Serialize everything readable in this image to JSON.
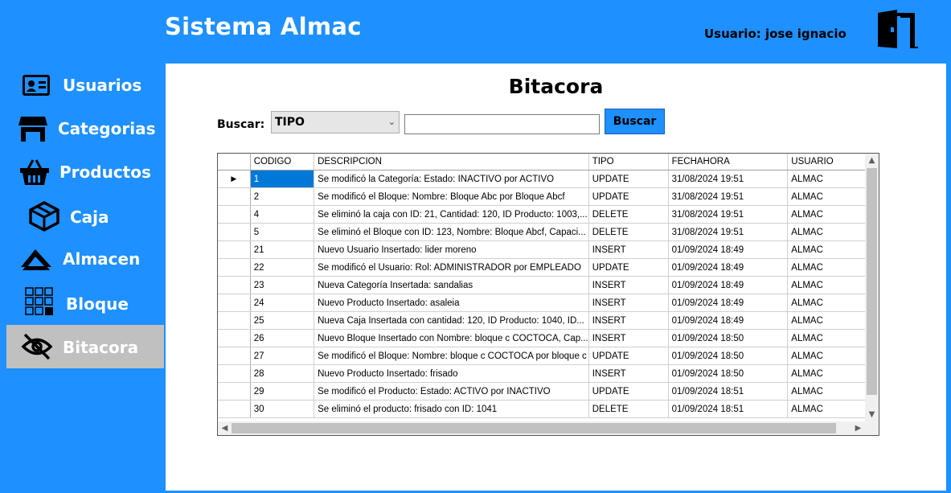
{
  "header": {
    "app_title": "Sistema Almac",
    "user_label": "Usuario: jose ignacio",
    "exit_icon": "door-exit-icon"
  },
  "sidebar": {
    "items": [
      {
        "label": "Usuarios",
        "icon": "id-card-icon"
      },
      {
        "label": "Categorias",
        "icon": "store-icon"
      },
      {
        "label": "Productos",
        "icon": "basket-icon"
      },
      {
        "label": "Caja",
        "icon": "box-icon"
      },
      {
        "label": "Almacen",
        "icon": "warehouse-icon"
      },
      {
        "label": "Bloque",
        "icon": "grid-blocks-icon"
      },
      {
        "label": "Bitacora",
        "icon": "eye-slash-icon",
        "active": true
      }
    ]
  },
  "main": {
    "title": "Bitacora",
    "search": {
      "label": "Buscar:",
      "select_value": "TIPO",
      "input_value": "",
      "button_label": "Buscar"
    },
    "table": {
      "columns": [
        "CODIGO",
        "DESCRIPCION",
        "TIPO",
        "FECHAHORA",
        "USUARIO"
      ],
      "rows": [
        [
          "1",
          "Se modificó la Categoría: Estado: INACTIVO por ACTIVO",
          "UPDATE",
          "31/08/2024 19:51",
          "ALMAC"
        ],
        [
          "2",
          "Se modificó el Bloque: Nombre: Bloque Abc por Bloque Abcf",
          "UPDATE",
          "31/08/2024 19:51",
          "ALMAC"
        ],
        [
          "4",
          "Se eliminó la caja con ID: 21, Cantidad: 120, ID Producto: 1003,...",
          "DELETE",
          "31/08/2024 19:51",
          "ALMAC"
        ],
        [
          "5",
          "Se eliminó el Bloque con ID: 123, Nombre: Bloque Abcf, Capaci...",
          "DELETE",
          "31/08/2024 19:51",
          "ALMAC"
        ],
        [
          "21",
          "Nuevo Usuario Insertado: lider moreno",
          "INSERT",
          "01/09/2024 18:49",
          "ALMAC"
        ],
        [
          "22",
          "Se modificó el Usuario: Rol: ADMINISTRADOR por EMPLEADO",
          "UPDATE",
          "01/09/2024 18:49",
          "ALMAC"
        ],
        [
          "23",
          "Nueva Categoría Insertada: sandalias",
          "INSERT",
          "01/09/2024 18:49",
          "ALMAC"
        ],
        [
          "24",
          "Nuevo Producto Insertado: asaleia",
          "INSERT",
          "01/09/2024 18:49",
          "ALMAC"
        ],
        [
          "25",
          "Nueva Caja Insertada con cantidad: 120, ID Producto: 1040, ID...",
          "INSERT",
          "01/09/2024 18:49",
          "ALMAC"
        ],
        [
          "26",
          "Nuevo Bloque Insertado con Nombre: bloque c COCTOCA, Cap...",
          "INSERT",
          "01/09/2024 18:50",
          "ALMAC"
        ],
        [
          "27",
          "Se modificó el Bloque: Nombre: bloque c COCTOCA por bloque c",
          "UPDATE",
          "01/09/2024 18:50",
          "ALMAC"
        ],
        [
          "28",
          "Nuevo Producto Insertado: frisado",
          "INSERT",
          "01/09/2024 18:50",
          "ALMAC"
        ],
        [
          "29",
          "Se modificó el Producto: Estado: ACTIVO por INACTIVO",
          "UPDATE",
          "01/09/2024 18:51",
          "ALMAC"
        ],
        [
          "30",
          "Se eliminó el producto: frisado con ID: 1041",
          "DELETE",
          "01/09/2024 18:51",
          "ALMAC"
        ]
      ]
    }
  },
  "colors": {
    "brand_blue": "#1e90ff",
    "active_item": "#c0c0c0",
    "selection": "#0078d7"
  }
}
